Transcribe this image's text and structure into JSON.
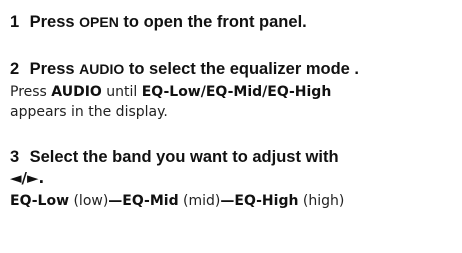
{
  "steps": [
    {
      "number": "1",
      "pre": "Press ",
      "key": "OPEN",
      "post": " to open the front panel."
    },
    {
      "number": "2",
      "pre": "Press ",
      "key": "AUDIO",
      "post": " to select the  equalizer mode .",
      "body_pre": "Press ",
      "body_key": "AUDIO",
      "body_mid": " until ",
      "body_modes": "EQ-Low/EQ-Mid/EQ-High",
      "body_end": "appears in the display."
    },
    {
      "number": "3",
      "text": "Select the band you want to adjust with",
      "arrows": "◄/►.",
      "bands": [
        {
          "name": "EQ-Low",
          "desc": " (low)",
          "sep": "—"
        },
        {
          "name": "EQ-Mid",
          "desc": " (mid)",
          "sep": "—"
        },
        {
          "name": "EQ-High",
          "desc": " (high)",
          "sep": ""
        }
      ]
    }
  ]
}
